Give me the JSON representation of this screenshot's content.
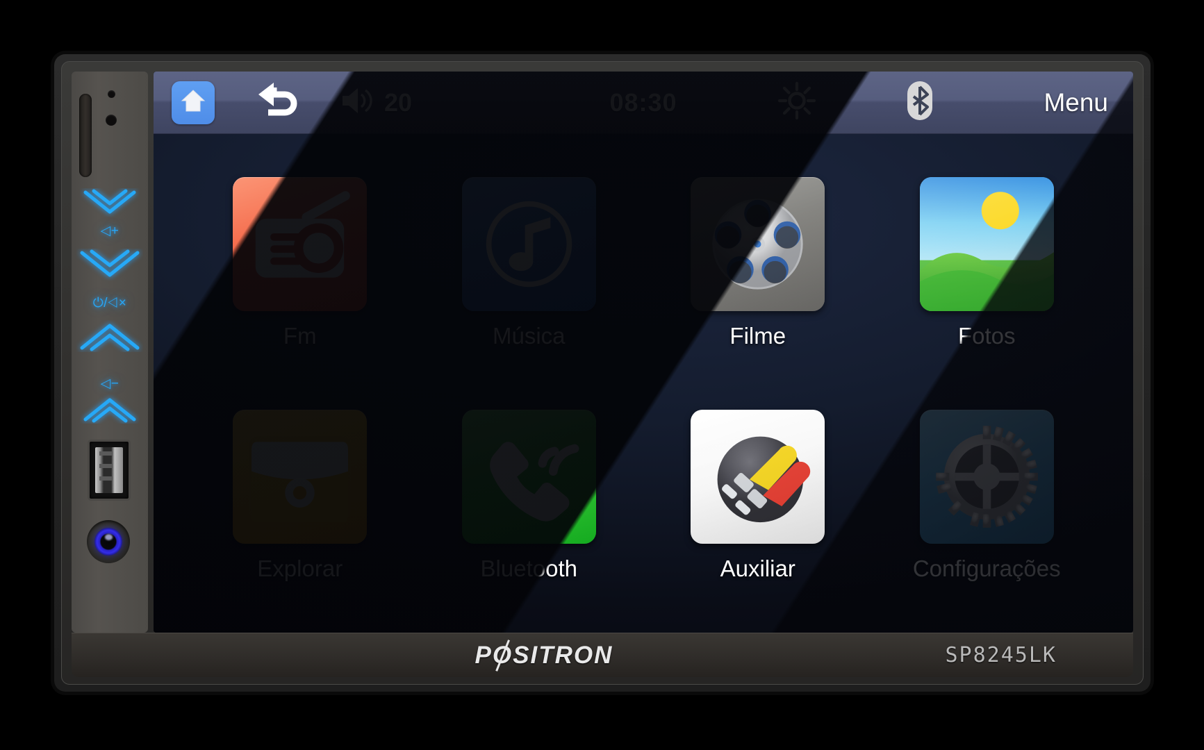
{
  "device": {
    "brand": "PØSITRON",
    "brand_prefix": "P",
    "brand_suffix": "SITRON",
    "model": "SP8245LK"
  },
  "left_panel": {
    "controls": [
      {
        "name": "seek-down-chevron",
        "icon": "double-chevron-down",
        "label": ""
      },
      {
        "name": "volume-up",
        "icon": "speaker-plus",
        "label": "◁+"
      },
      {
        "name": "seek-down-chevron-2",
        "icon": "double-chevron-down",
        "label": ""
      },
      {
        "name": "power-mute",
        "icon": "power-mute",
        "label": "⏻/◁×"
      },
      {
        "name": "seek-up-chevron",
        "icon": "double-chevron-up",
        "label": ""
      },
      {
        "name": "volume-down",
        "icon": "speaker-minus",
        "label": "◁−"
      },
      {
        "name": "seek-up-chevron-2",
        "icon": "double-chevron-up",
        "label": ""
      }
    ],
    "usb_port_label": "USB",
    "ir_sensor_label": "IR"
  },
  "status_bar": {
    "home_icon": "home-icon",
    "back_icon": "back-arrow-icon",
    "volume_icon": "speaker-icon",
    "volume_level": "20",
    "clock": "08:30",
    "brightness_icon": "sun-icon",
    "bluetooth_icon": "bluetooth-icon",
    "menu_label": "Menu"
  },
  "apps": [
    {
      "id": "fm",
      "label": "Fm",
      "icon": "radio-icon",
      "tile_class": "tile-fm",
      "color": "#f3603f"
    },
    {
      "id": "musica",
      "label": "Música",
      "icon": "music-note-icon",
      "tile_class": "tile-music",
      "color": "#3f7fdd"
    },
    {
      "id": "filme",
      "label": "Filme",
      "icon": "film-reel-icon",
      "tile_class": "tile-movie",
      "color": "#7c7b77"
    },
    {
      "id": "fotos",
      "label": "Fotos",
      "icon": "landscape-icon",
      "tile_class": "tile-photo",
      "color": "#5cc2f0"
    },
    {
      "id": "explorar",
      "label": "Explorar",
      "icon": "folder-icon",
      "tile_class": "tile-explore",
      "color": "#fdb813"
    },
    {
      "id": "bluetooth",
      "label": "Bluetooth",
      "icon": "phone-call-icon",
      "tile_class": "tile-bt",
      "color": "#2fc82f"
    },
    {
      "id": "auxiliar",
      "label": "Auxiliar",
      "icon": "rca-plug-icon",
      "tile_class": "tile-aux",
      "color": "#f6f6f6"
    },
    {
      "id": "config",
      "label": "Configurações",
      "icon": "gear-icon",
      "tile_class": "tile-config",
      "color": "#4ba5dd"
    }
  ],
  "theme": {
    "status_bar_color": "#565d7e",
    "screen_bg": "#141c2e",
    "accent_blue": "#27a6f5",
    "bezel_color": "#302f2d"
  }
}
